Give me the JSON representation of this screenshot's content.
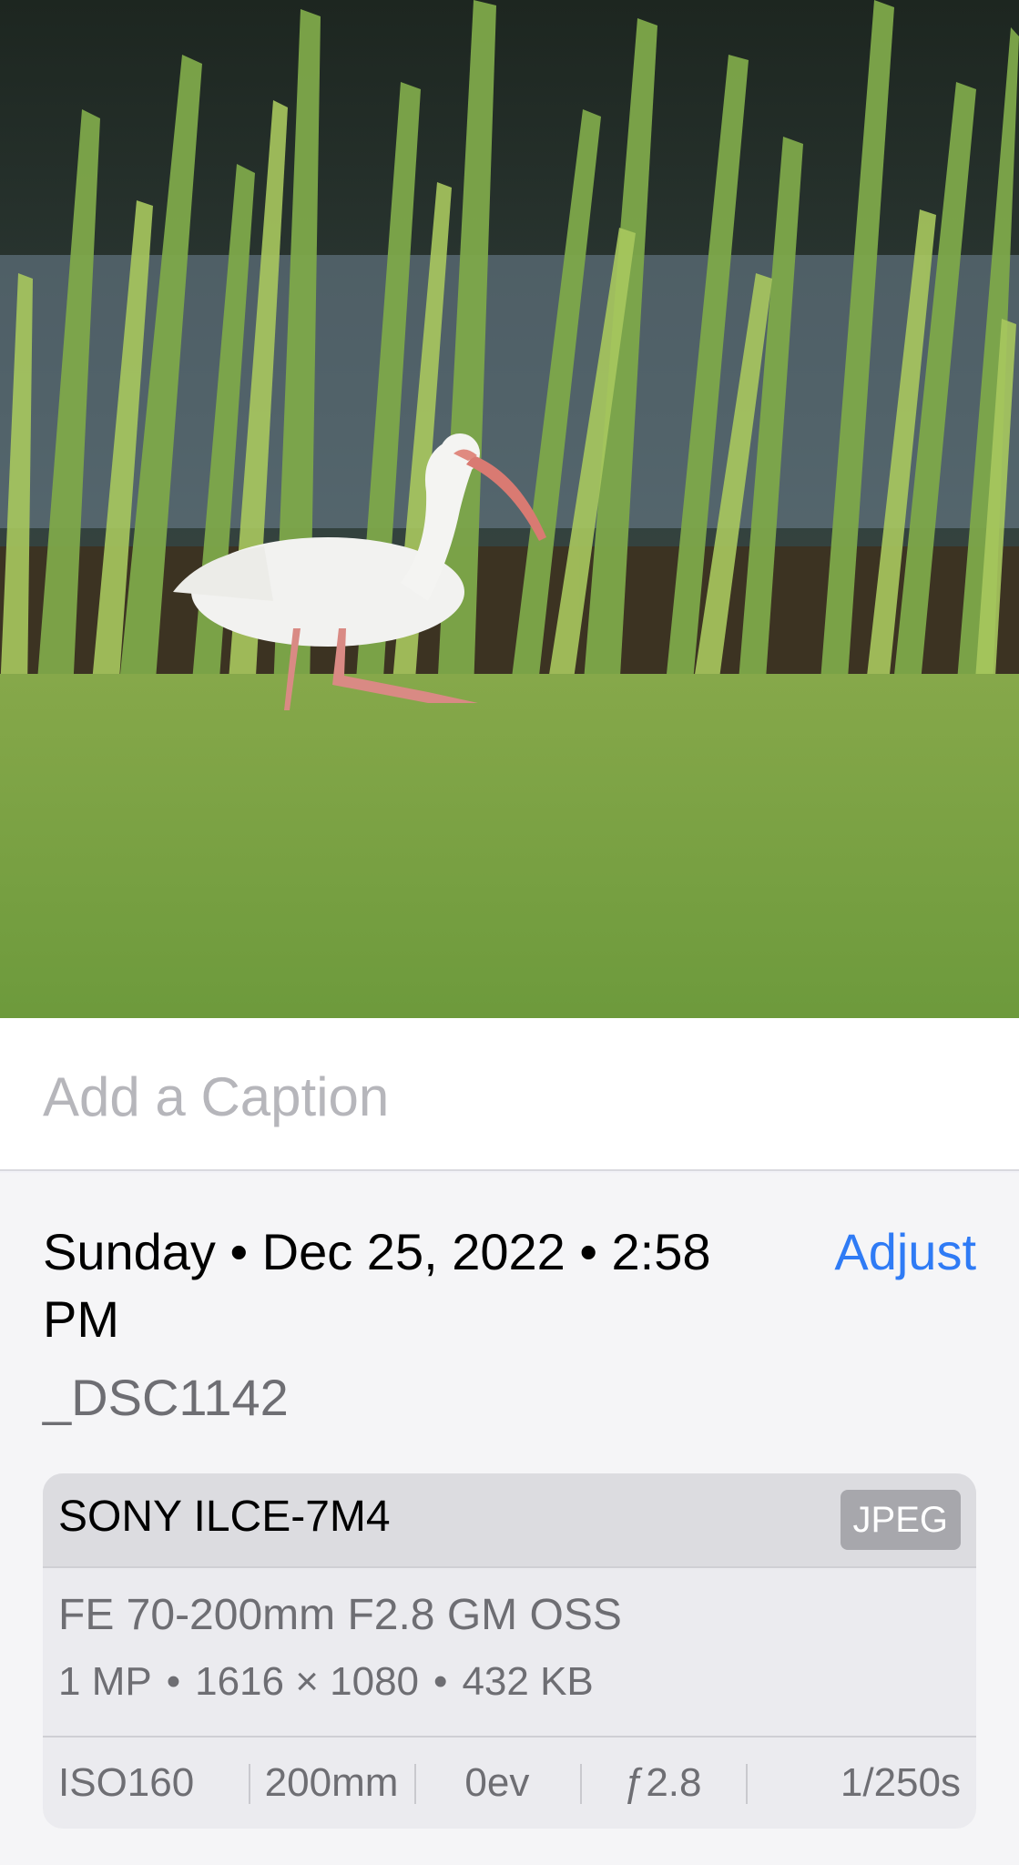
{
  "photo": {
    "subject": "white ibis walking on grass in front of tall reeds by water"
  },
  "caption": {
    "placeholder": "Add a Caption"
  },
  "info": {
    "date_line": "Sunday • Dec 25, 2022 • 2:58 PM",
    "adjust_label": "Adjust",
    "filename": "_DSC1142"
  },
  "camera_card": {
    "camera": "SONY ILCE-7M4",
    "format_badge": "JPEG",
    "lens": "FE 70-200mm F2.8 GM OSS",
    "megapixels": "1 MP",
    "resolution": "1616 × 1080",
    "file_size": "432 KB",
    "separator": "•",
    "exif": {
      "iso": "ISO160",
      "focal_length": "200mm",
      "exposure_bias": "0ev",
      "aperture": "ƒ2.8",
      "shutter": "1/250s"
    }
  },
  "colors": {
    "accent": "#2f7bf5",
    "background": "#f5f5f7",
    "card_header": "#dcdce0",
    "badge": "#a7a7ac"
  }
}
